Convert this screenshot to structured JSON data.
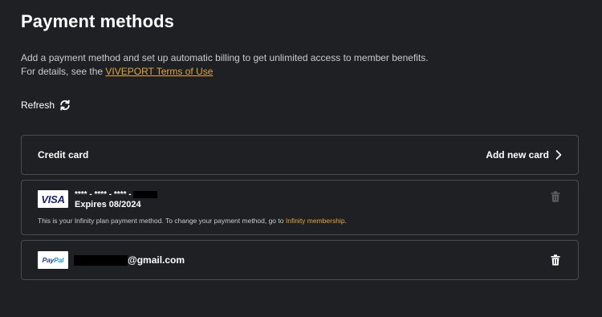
{
  "page": {
    "title": "Payment methods",
    "description_line1": "Add a payment method and set up automatic billing to get unlimited access to member benefits.",
    "description_line2_prefix": "For details, see the ",
    "terms_link": "VIVEPORT Terms of Use",
    "refresh_label": "Refresh"
  },
  "credit_card": {
    "header_label": "Credit card",
    "add_new_card_label": "Add new card"
  },
  "cards": [
    {
      "brand": "VISA",
      "number_masked": "**** - **** - **** -",
      "expiry": "Expires 08/2024",
      "note_prefix": "This is your Infinity plan payment method. To change your payment method, go to ",
      "note_link": "Infinity membership",
      "note_suffix": "."
    }
  ],
  "paypal": {
    "logo_part1": "Pay",
    "logo_part2": "Pal",
    "email_suffix": "@gmail.com"
  },
  "colors": {
    "background": "#1f2024",
    "border": "#4a4c52",
    "link": "#e3a63a",
    "text_secondary": "#c9cbd0"
  },
  "icons": {
    "refresh": "refresh-icon",
    "chevron": "chevron-right-icon",
    "delete": "trash-icon"
  }
}
